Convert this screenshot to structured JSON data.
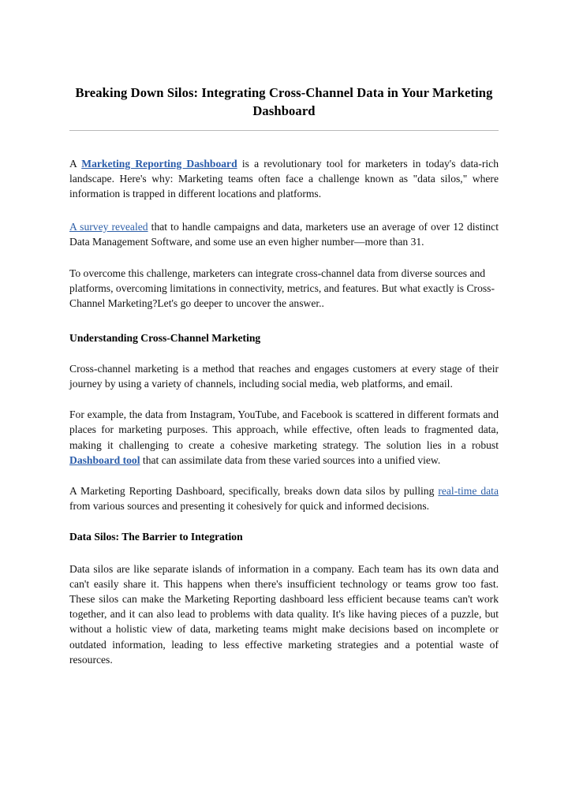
{
  "document": {
    "title_line_1": "Breaking Down Silos: Integrating Cross-Channel Data in Your",
    "title_line_2": "Marketing Dashboard",
    "title_full": "Breaking Down Silos: Integrating Cross-Channel Data in Your Marketing Dashboard"
  },
  "colors": {
    "page_background": "#ffffff",
    "body_text": "#111111",
    "link": "#2d5fa8",
    "link_bold": "#2a5caa",
    "rule": "#b9b9b9"
  },
  "paragraphs": {
    "p1": {
      "lead": "A ",
      "link_text": "Marketing Reporting Dashboard",
      "rest": " is a revolutionary tool for marketers in today's data-rich landscape. Here's why: Marketing teams often face a challenge known as \"data silos,\" where information is trapped in different locations and platforms."
    },
    "p2": {
      "link_text": "A survey revealed",
      "rest": " that to handle campaigns and data, marketers use an average of over 12 distinct Data Management Software, and some use an even higher number—more than 31."
    },
    "p3": {
      "text": "To overcome this challenge, marketers can integrate cross-channel data from diverse sources and platforms, overcoming limitations in connectivity, metrics, and features. But what exactly is Cross-Channel Marketing?Let's go deeper to uncover the answer.."
    },
    "p4": {
      "text": "Cross-channel marketing is a method that reaches and engages customers at every stage of their journey by using a variety of channels, including social media, web platforms, and email."
    },
    "p5": {
      "lead": "For example, the data from Instagram, YouTube, and Facebook is scattered in different formats and places for marketing purposes. This approach, while effective, often leads to fragmented data, making it challenging to create a cohesive marketing strategy. The solution lies in a robust ",
      "link_text": "Dashboard tool",
      "rest": " that can assimilate data from these varied sources into a unified view."
    },
    "p6": {
      "lead": "A Marketing Reporting Dashboard, specifically, breaks down data silos by pulling ",
      "link_text": "real-time data",
      "rest": " from various sources and presenting it cohesively for quick and informed decisions."
    },
    "p7": {
      "text": "Data silos are like separate islands of information in a company. Each team has its own data and can't easily share it. This happens when there's insufficient technology or teams grow too fast. These silos can make the Marketing Reporting dashboard less efficient because teams can't work together, and it can also lead to problems with data quality. It's like having pieces of a puzzle, but without a holistic view of data, marketing teams might make decisions based on incomplete or outdated information, leading to less effective marketing strategies and a potential waste of resources."
    }
  },
  "headings": {
    "h1": "Understanding Cross-Channel Marketing",
    "h2": "Data Silos: The Barrier to Integration"
  }
}
